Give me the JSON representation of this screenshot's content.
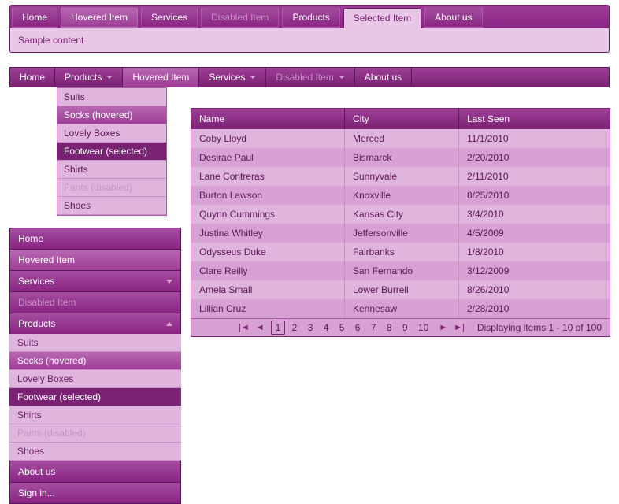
{
  "tabs": {
    "items": [
      "Home",
      "Hovered Item",
      "Services",
      "Disabled Item",
      "Products",
      "Selected Item",
      "About us"
    ],
    "content": "Sample content"
  },
  "hmenu": {
    "items": [
      "Home",
      "Products",
      "Hovered Item",
      "Services",
      "Disabled Item",
      "About us"
    ]
  },
  "submenu": [
    "Suits",
    "Socks (hovered)",
    "Lovely Boxes",
    "Footwear (selected)",
    "Shirts",
    "Pants (disabled)",
    "Shoes"
  ],
  "vside": {
    "items": [
      "Home",
      "Hovered Item",
      "Services",
      "Disabled Item",
      "Products",
      "About us",
      "Sign in..."
    ]
  },
  "grid": {
    "cols": [
      "Name",
      "City",
      "Last Seen"
    ],
    "rows": [
      [
        "Coby Lloyd",
        "Merced",
        "11/1/2010"
      ],
      [
        "Desirae Paul",
        "Bismarck",
        "2/20/2010"
      ],
      [
        "Lane Contreras",
        "Sunnyvale",
        "2/11/2010"
      ],
      [
        "Burton Lawson",
        "Knoxville",
        "8/25/2010"
      ],
      [
        "Quynn Cummings",
        "Kansas City",
        "3/4/2010"
      ],
      [
        "Justina Whitley",
        "Jeffersonville",
        "4/5/2009"
      ],
      [
        "Odysseus Duke",
        "Fairbanks",
        "1/8/2010"
      ],
      [
        "Clare Reilly",
        "San Fernando",
        "3/12/2009"
      ],
      [
        "Amela Small",
        "Lower Burrell",
        "8/26/2010"
      ],
      [
        "Lillian Cruz",
        "Kennesaw",
        "2/28/2010"
      ]
    ],
    "pages": [
      "1",
      "2",
      "3",
      "4",
      "5",
      "6",
      "7",
      "8",
      "9",
      "10"
    ],
    "info": "Displaying items 1 - 10 of 100"
  }
}
